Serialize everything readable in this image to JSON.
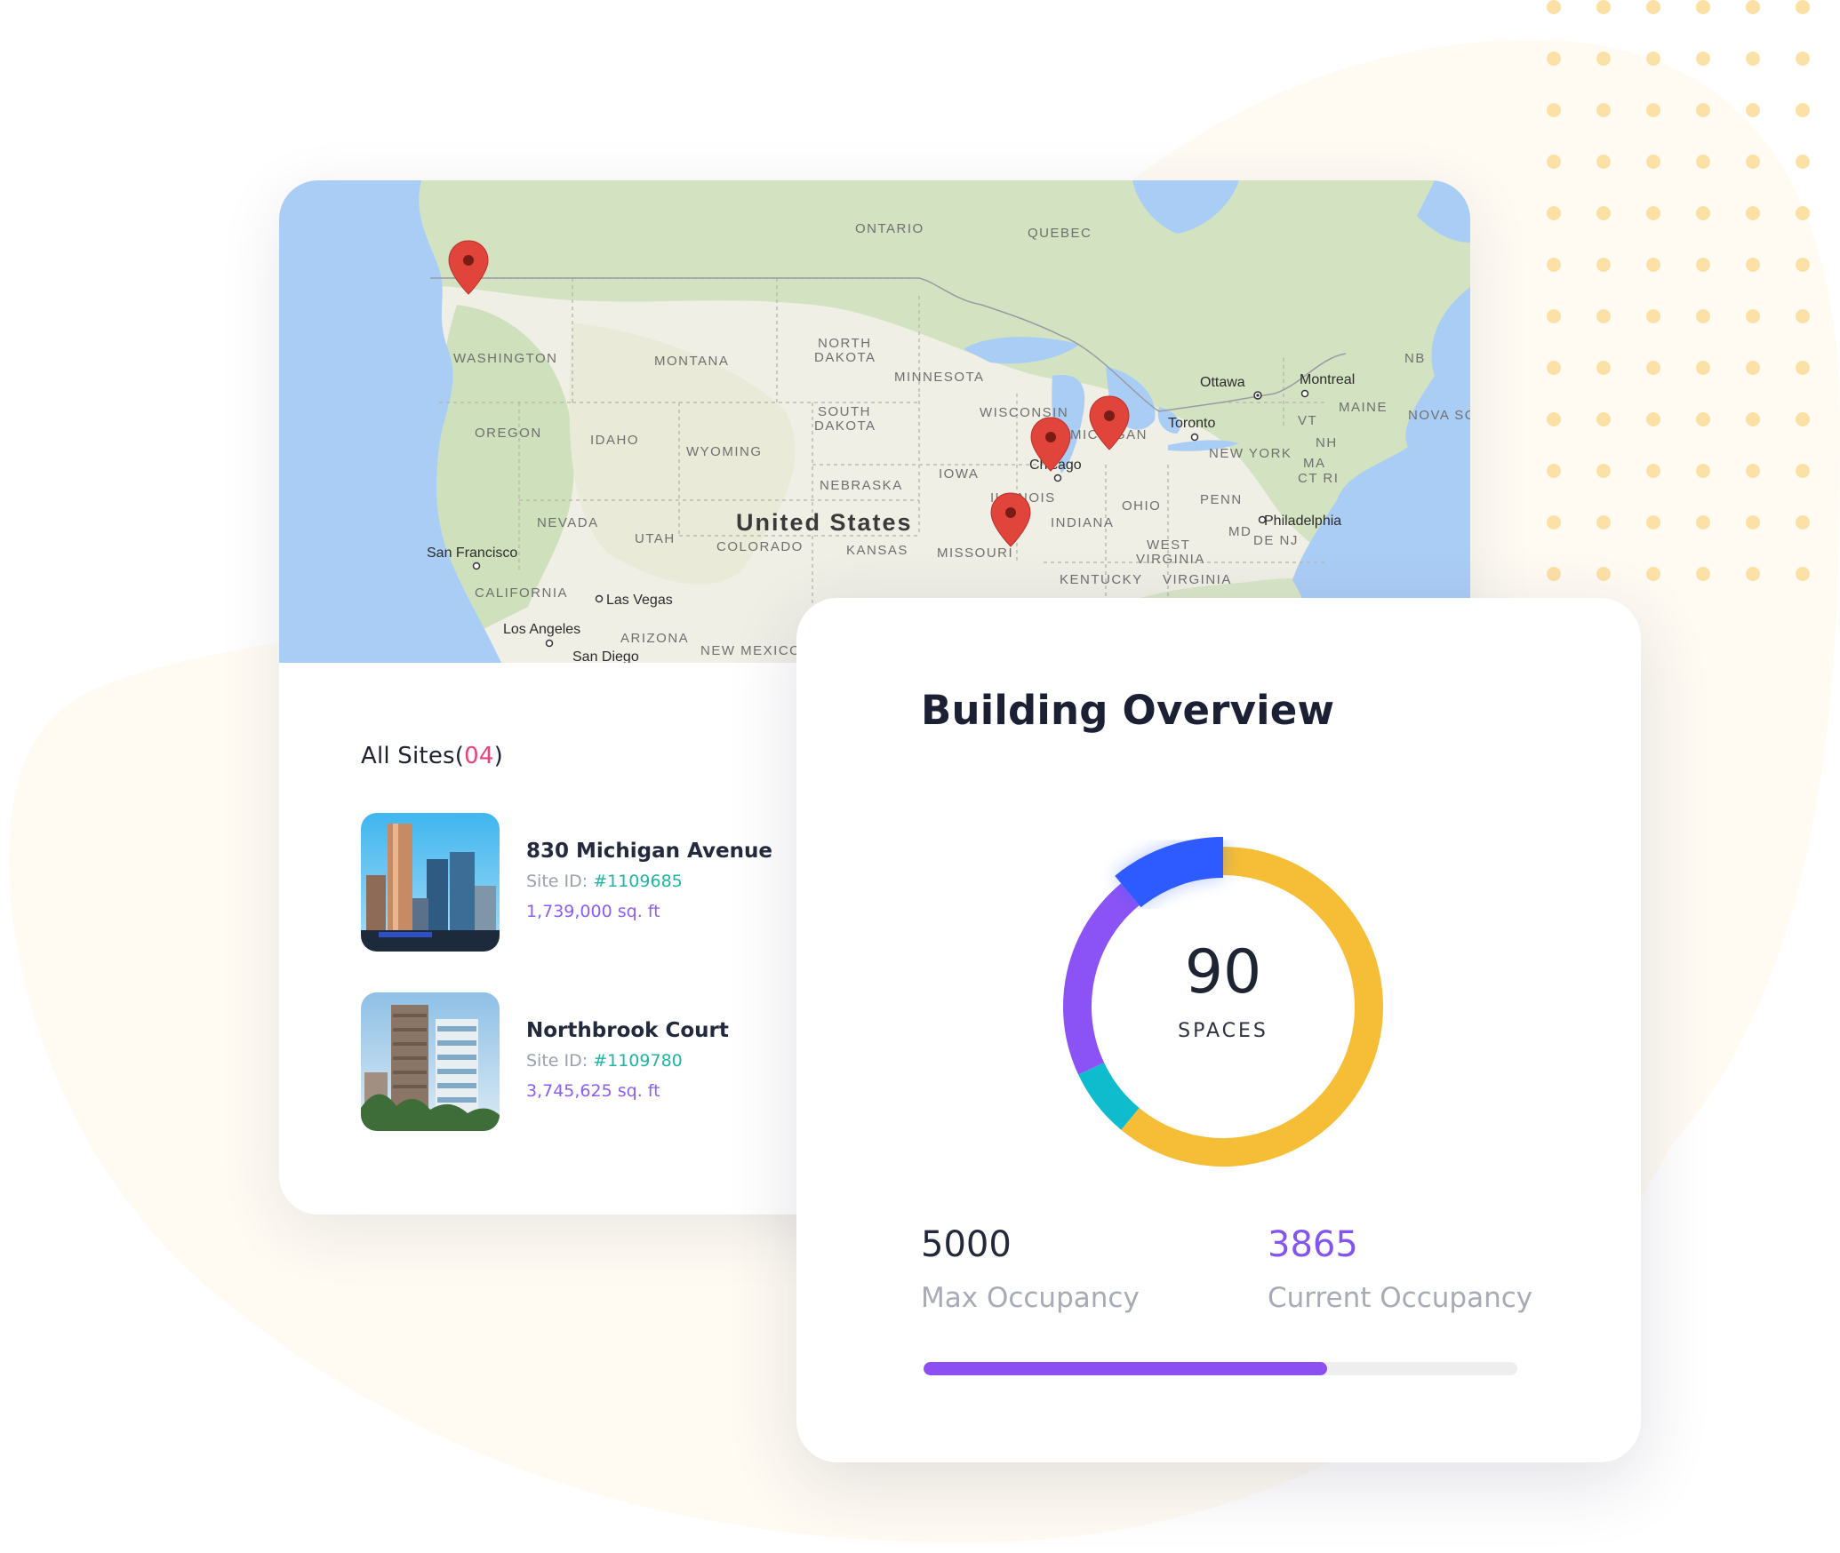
{
  "colors": {
    "accent_purple": "#8b5cf6",
    "count_pink": "#ec4179",
    "site_id_teal": "#1fb5a4",
    "donut_yellow": "#f5be36",
    "donut_blue": "#2d5bff",
    "donut_purple": "#8b53f5",
    "donut_teal": "#0fbccd"
  },
  "map": {
    "country_label": "United States",
    "region_labels": [
      "ONTARIO",
      "QUEBEC",
      "WASHINGTON",
      "MONTANA",
      "NORTH",
      "DAKOTA",
      "MINNESOTA",
      "SOUTH",
      "DAKOTA",
      "WISCONSIN",
      "MICHIGAN",
      "OREGON",
      "IDAHO",
      "WYOMING",
      "IOWA",
      "NEBRASKA",
      "ILLINOIS",
      "INDIANA",
      "OHIO",
      "PENN",
      "NEVADA",
      "UTAH",
      "COLORADO",
      "KANSAS",
      "MISSOURI",
      "KENTUCKY",
      "WEST",
      "VIRGINIA",
      "VIRGINIA",
      "CALIFORNIA",
      "ARIZONA",
      "NEW MEXICO",
      "NEW YORK",
      "MAINE",
      "NB",
      "VT",
      "NH",
      "MA",
      "CT RI",
      "MD",
      "DE NJ",
      "NOVA SC"
    ],
    "city_labels": [
      "Ottawa",
      "Montreal",
      "Toronto",
      "Chicago",
      "Philadelphia",
      "San Francisco",
      "Las Vegas",
      "Los Angeles",
      "San Diego"
    ],
    "markers": [
      "marker-vancouver",
      "marker-chicago",
      "marker-michigan",
      "marker-missouri"
    ]
  },
  "sites": {
    "title": "All Sites",
    "count_open": "(",
    "count": "04",
    "count_close": ")",
    "id_prefix": "Site ID: ",
    "items": [
      {
        "name": "830 Michigan Avenue",
        "id": "#1109685",
        "area": "1,739,000 sq. ft"
      },
      {
        "name": "Northbrook Court",
        "id": "#1109780",
        "area": "3,745,625 sq. ft"
      }
    ]
  },
  "overview": {
    "title": "Building Overview",
    "center_value": "90",
    "center_label": "SPACES",
    "max_value": "5000",
    "max_label": "Max Occupancy",
    "current_value": "3865",
    "current_label": "Current Occupancy",
    "progress_percent": 68
  },
  "chart_data": {
    "type": "pie",
    "title": "",
    "segments": [
      {
        "color": "#f5be36",
        "percent": 61
      },
      {
        "color": "#0fbccd",
        "percent": 7
      },
      {
        "color": "#8b53f5",
        "percent": 21
      },
      {
        "color": "#2d5bff",
        "percent": 11
      }
    ]
  }
}
